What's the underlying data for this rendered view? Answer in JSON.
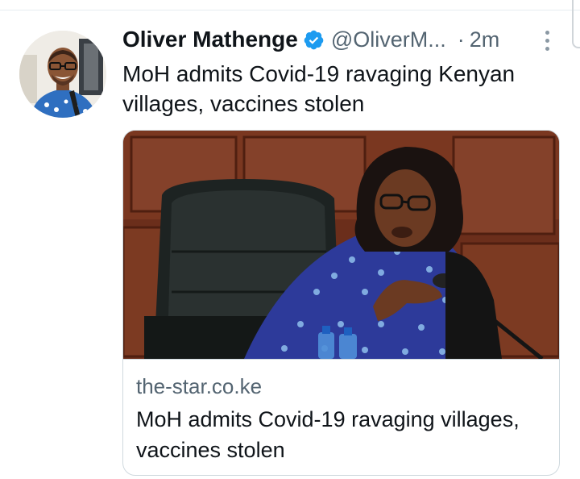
{
  "tweet": {
    "author_name": "Oliver Mathenge",
    "handle": "@OliverM...",
    "separator": "·",
    "timestamp": "2m",
    "text": "MoH admits Covid-19 ravaging Kenyan villages, vaccines stolen",
    "verified": true
  },
  "card": {
    "domain": "the-star.co.ke",
    "title": "MoH admits Covid-19 ravaging villages, vaccines stolen"
  },
  "icons": {
    "verified": "verified-badge-icon",
    "more": "more-options-icon"
  },
  "colors": {
    "verified_blue": "#1d9bf0",
    "secondary_text": "#536471",
    "primary_text": "#0f1419",
    "border": "#cfd9de"
  }
}
